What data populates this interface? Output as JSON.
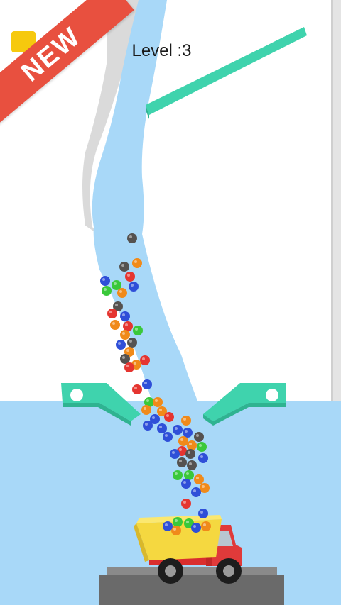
{
  "hud": {
    "level_text": "Level :3",
    "badge_text": "NEW"
  },
  "colors": {
    "water": "#a8d8f8",
    "wall": "#e9e9e9",
    "accent_paddle": "#3fd3ad",
    "ribbon": "#e8503f",
    "truck_bed": "#f5d840",
    "truck_cab": "#e03a3a",
    "ground": "#707070"
  },
  "balls": {
    "palette": [
      "#e53530",
      "#2f4fd8",
      "#f08a1a",
      "#3ac83a",
      "#555250"
    ],
    "count": 86
  }
}
